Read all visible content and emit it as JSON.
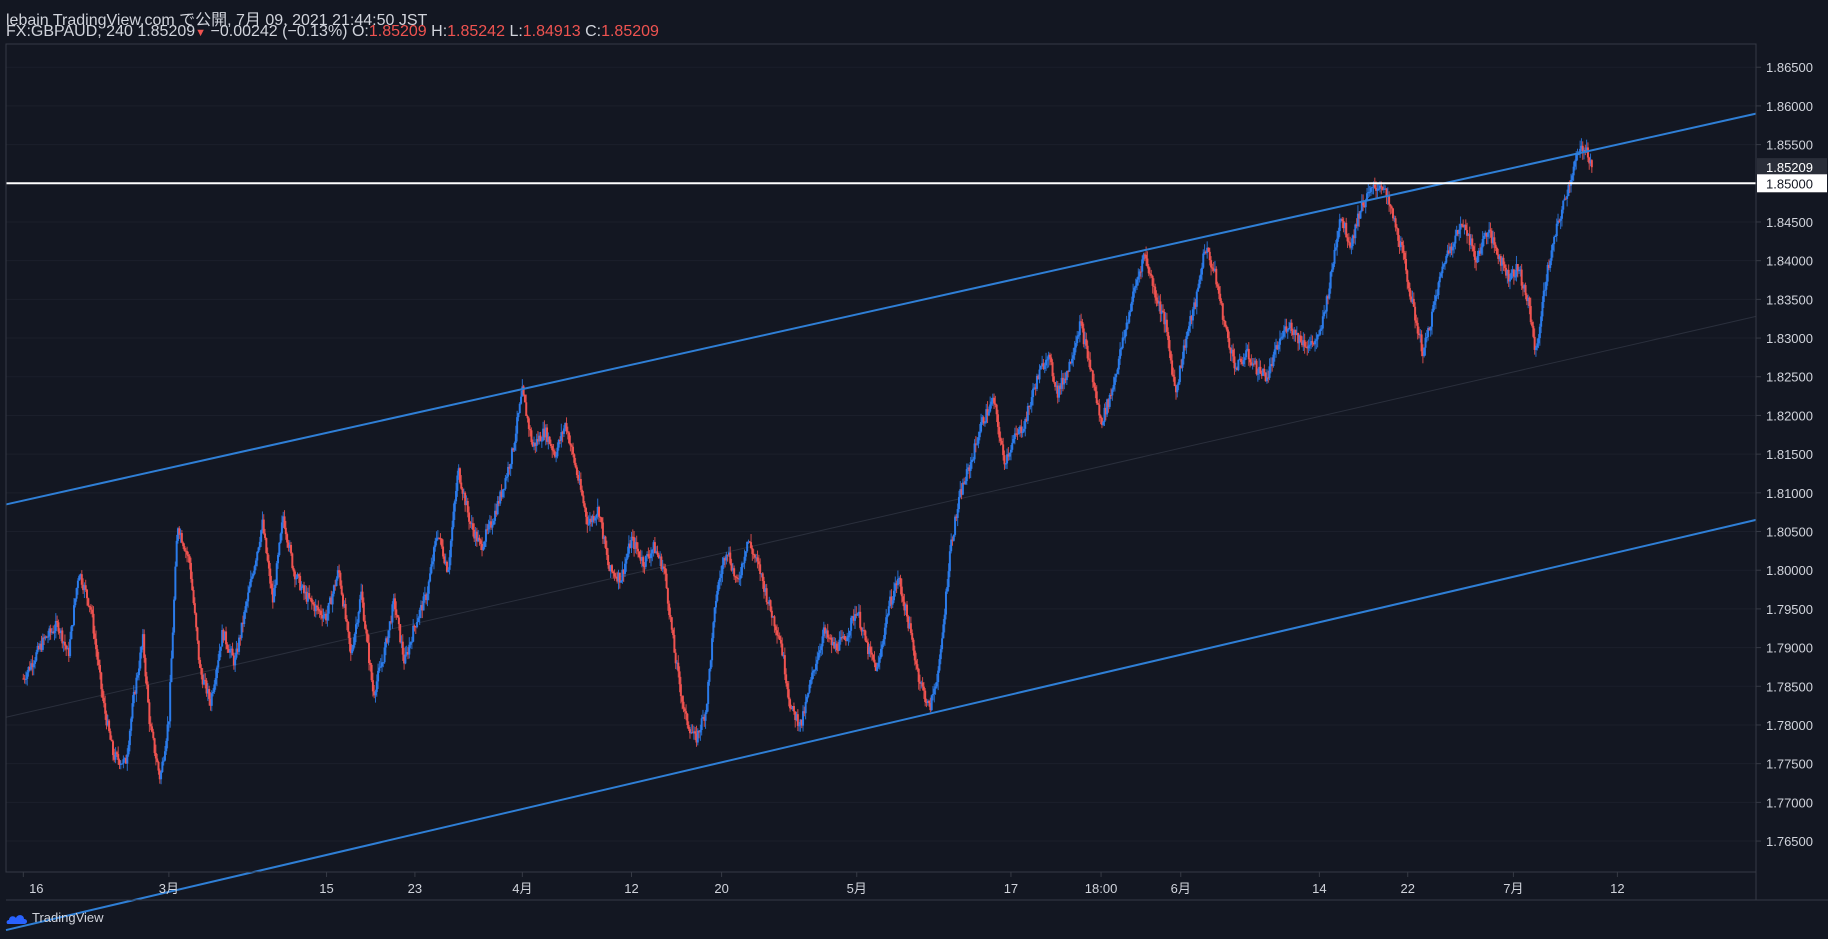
{
  "header": {
    "line1": "lebain TradingView.com で公開, 7月 09, 2021 21:44:50 JST",
    "symbol": "FX:GBPAUD, 240",
    "last": "1.85209",
    "change": "−0.00242 (−0.13%)",
    "o_label": "O:",
    "o_value": "1.85209",
    "h_label": "H:",
    "h_value": "1.85242",
    "l_label": "L:",
    "l_value": "1.84913",
    "c_label": "C:",
    "c_value": "1.85209"
  },
  "footer": {
    "brand": "TradingView"
  },
  "colors": {
    "bg": "#131722",
    "up": "#2962ff",
    "down": "#ef5350",
    "channel": "#2f7fd6",
    "grid": "#363a45",
    "text": "#d1d4dc"
  },
  "chart_data": {
    "type": "candlestick",
    "symbol": "FX:GBPAUD",
    "interval": "240",
    "ylim": [
      1.761,
      1.868
    ],
    "y_ticks": [
      "1.86500",
      "1.86000",
      "1.85500",
      "1.85000",
      "1.84500",
      "1.84000",
      "1.83500",
      "1.83000",
      "1.82500",
      "1.82000",
      "1.81500",
      "1.81000",
      "1.80500",
      "1.80000",
      "1.79500",
      "1.79000",
      "1.78500",
      "1.78000",
      "1.77500",
      "1.77000",
      "1.76500"
    ],
    "x_ticks": [
      "16",
      "3月",
      "15",
      "23",
      "4月",
      "12",
      "20",
      "5月",
      "17",
      "18:00",
      "6月",
      "14",
      "22",
      "7月",
      "12"
    ],
    "x_tick_positions": [
      0.0,
      8.4,
      17.5,
      22.6,
      28.8,
      35.1,
      40.3,
      48.1,
      57.0,
      62.2,
      66.8,
      74.8,
      79.9,
      86.0,
      92.0
    ],
    "x_range": [
      -1.0,
      100.0
    ],
    "price_labels": [
      {
        "value": 1.85209,
        "text": "1.85209"
      },
      {
        "value": 1.85,
        "text": "1.85000"
      }
    ],
    "horizontal_line": 1.85,
    "channel_lines": [
      {
        "x1": -1.0,
        "y1": 1.8085,
        "x2": 100.0,
        "y2": 1.859
      },
      {
        "x1": -1.0,
        "y1": 1.7535,
        "x2": 100.0,
        "y2": 1.8065
      }
    ],
    "mid_line": {
      "x1": -1.0,
      "y1": 1.781,
      "x2": 100.0,
      "y2": 1.8328
    },
    "path": [
      [
        0.0,
        1.786
      ],
      [
        1.2,
        1.791
      ],
      [
        2.0,
        1.793
      ],
      [
        2.6,
        1.789
      ],
      [
        3.2,
        1.8
      ],
      [
        3.9,
        1.795
      ],
      [
        4.6,
        1.783
      ],
      [
        5.2,
        1.776
      ],
      [
        5.9,
        1.775
      ],
      [
        6.4,
        1.784
      ],
      [
        6.9,
        1.791
      ],
      [
        7.3,
        1.78
      ],
      [
        7.9,
        1.773
      ],
      [
        8.4,
        1.781
      ],
      [
        8.9,
        1.806
      ],
      [
        9.6,
        1.801
      ],
      [
        10.2,
        1.787
      ],
      [
        10.8,
        1.783
      ],
      [
        11.5,
        1.792
      ],
      [
        12.2,
        1.788
      ],
      [
        13.0,
        1.797
      ],
      [
        13.8,
        1.806
      ],
      [
        14.4,
        1.796
      ],
      [
        15.0,
        1.807
      ],
      [
        15.6,
        1.8
      ],
      [
        16.2,
        1.797
      ],
      [
        16.9,
        1.795
      ],
      [
        17.5,
        1.794
      ],
      [
        18.2,
        1.8
      ],
      [
        18.9,
        1.789
      ],
      [
        19.5,
        1.797
      ],
      [
        20.2,
        1.784
      ],
      [
        20.8,
        1.789
      ],
      [
        21.4,
        1.796
      ],
      [
        22.0,
        1.788
      ],
      [
        22.6,
        1.793
      ],
      [
        23.3,
        1.797
      ],
      [
        23.9,
        1.805
      ],
      [
        24.5,
        1.8
      ],
      [
        25.1,
        1.813
      ],
      [
        25.8,
        1.806
      ],
      [
        26.4,
        1.803
      ],
      [
        27.0,
        1.806
      ],
      [
        27.6,
        1.81
      ],
      [
        28.2,
        1.815
      ],
      [
        28.8,
        1.823
      ],
      [
        29.4,
        1.816
      ],
      [
        30.1,
        1.818
      ],
      [
        30.7,
        1.815
      ],
      [
        31.3,
        1.819
      ],
      [
        32.0,
        1.812
      ],
      [
        32.6,
        1.806
      ],
      [
        33.2,
        1.808
      ],
      [
        33.8,
        1.8
      ],
      [
        34.5,
        1.799
      ],
      [
        35.1,
        1.804
      ],
      [
        35.8,
        1.801
      ],
      [
        36.4,
        1.803
      ],
      [
        37.0,
        1.8
      ],
      [
        37.6,
        1.789
      ],
      [
        38.2,
        1.781
      ],
      [
        38.8,
        1.778
      ],
      [
        39.4,
        1.782
      ],
      [
        40.0,
        1.797
      ],
      [
        40.6,
        1.803
      ],
      [
        41.2,
        1.798
      ],
      [
        41.8,
        1.804
      ],
      [
        42.5,
        1.8
      ],
      [
        43.1,
        1.795
      ],
      [
        43.7,
        1.791
      ],
      [
        44.3,
        1.782
      ],
      [
        44.9,
        1.78
      ],
      [
        45.6,
        1.787
      ],
      [
        46.2,
        1.792
      ],
      [
        46.8,
        1.79
      ],
      [
        47.4,
        1.791
      ],
      [
        48.1,
        1.795
      ],
      [
        48.7,
        1.79
      ],
      [
        49.3,
        1.787
      ],
      [
        49.9,
        1.795
      ],
      [
        50.5,
        1.799
      ],
      [
        51.1,
        1.793
      ],
      [
        51.7,
        1.786
      ],
      [
        52.3,
        1.782
      ],
      [
        52.9,
        1.788
      ],
      [
        53.5,
        1.803
      ],
      [
        54.1,
        1.81
      ],
      [
        54.7,
        1.814
      ],
      [
        55.3,
        1.819
      ],
      [
        56.0,
        1.822
      ],
      [
        56.6,
        1.814
      ],
      [
        57.2,
        1.817
      ],
      [
        57.8,
        1.819
      ],
      [
        58.4,
        1.824
      ],
      [
        59.1,
        1.828
      ],
      [
        59.7,
        1.823
      ],
      [
        60.3,
        1.826
      ],
      [
        61.0,
        1.832
      ],
      [
        61.6,
        1.826
      ],
      [
        62.2,
        1.819
      ],
      [
        62.8,
        1.823
      ],
      [
        63.5,
        1.83
      ],
      [
        64.1,
        1.836
      ],
      [
        64.7,
        1.841
      ],
      [
        65.3,
        1.836
      ],
      [
        65.9,
        1.832
      ],
      [
        66.5,
        1.823
      ],
      [
        67.1,
        1.83
      ],
      [
        67.7,
        1.835
      ],
      [
        68.2,
        1.842
      ],
      [
        68.8,
        1.838
      ],
      [
        69.4,
        1.831
      ],
      [
        70.0,
        1.826
      ],
      [
        70.6,
        1.828
      ],
      [
        71.2,
        1.826
      ],
      [
        71.8,
        1.825
      ],
      [
        72.4,
        1.829
      ],
      [
        73.0,
        1.832
      ],
      [
        73.6,
        1.83
      ],
      [
        74.2,
        1.829
      ],
      [
        74.8,
        1.83
      ],
      [
        75.4,
        1.837
      ],
      [
        76.0,
        1.846
      ],
      [
        76.6,
        1.842
      ],
      [
        77.2,
        1.847
      ],
      [
        77.8,
        1.849
      ],
      [
        78.4,
        1.85
      ],
      [
        79.0,
        1.846
      ],
      [
        79.6,
        1.841
      ],
      [
        80.2,
        1.834
      ],
      [
        80.8,
        1.828
      ],
      [
        81.4,
        1.834
      ],
      [
        82.0,
        1.84
      ],
      [
        82.6,
        1.843
      ],
      [
        83.2,
        1.845
      ],
      [
        83.8,
        1.84
      ],
      [
        84.5,
        1.844
      ],
      [
        85.1,
        1.841
      ],
      [
        85.7,
        1.838
      ],
      [
        86.3,
        1.839
      ],
      [
        86.9,
        1.834
      ],
      [
        87.3,
        1.828
      ],
      [
        87.9,
        1.838
      ],
      [
        88.5,
        1.844
      ],
      [
        89.1,
        1.849
      ],
      [
        89.6,
        1.853
      ],
      [
        90.1,
        1.855
      ],
      [
        90.6,
        1.852
      ]
    ]
  }
}
